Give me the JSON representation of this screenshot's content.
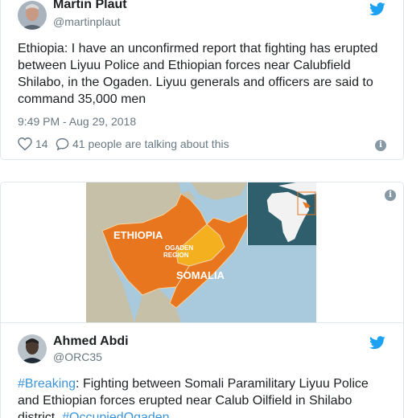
{
  "tweet1": {
    "author_name": "Martin Plaut",
    "author_handle": "@martinplaut",
    "text": "Ethiopia: I have an unconfirmed report that fighting has erupted between Liyuu Police and Ethiopian forces near Calubfield Shilabo, in the Ogaden. Liyuu generals and officers are said to command 35,000 men",
    "timestamp": "9:49 PM - Aug 29, 2018",
    "likes_count": "14",
    "replies_label": "41 people are talking about this"
  },
  "media": {
    "label_ethiopia": "ETHIOPIA",
    "label_ogaden": "OGADEN\nREGION",
    "label_somalia": "SOMALIA"
  },
  "tweet2": {
    "author_name": "Ahmed Abdi",
    "author_handle": "@ORC35",
    "hashtag_breaking": "#Breaking",
    "text_main": ": Fighting between Somali Paramilitary Liyuu Police and Ethiopian forces erupted near Calub Oilfield in Shilabo district.",
    "hashtag_ogaden": "#OccupiedOgaden"
  },
  "colors": {
    "twitter_blue": "#1da1f2",
    "ethiopia_orange": "#e8761e",
    "ogaden_yellow": "#f5b01f",
    "sea": "#a9c9dc"
  }
}
